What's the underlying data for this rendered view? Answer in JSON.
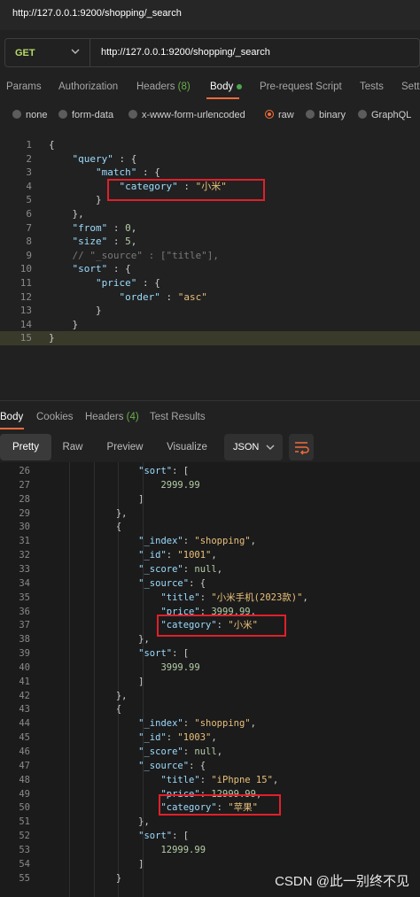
{
  "window": {
    "url_title": "http://127.0.0.1:9200/shopping/_search"
  },
  "request": {
    "method": "GET",
    "url": "http://127.0.0.1:9200/shopping/_search"
  },
  "request_tabs": {
    "params": "Params",
    "authorization": "Authorization",
    "headers": "Headers",
    "headers_count": "(8)",
    "body": "Body",
    "pre_request": "Pre-request Script",
    "tests": "Tests",
    "settings": "Settings"
  },
  "body_types": {
    "none": "none",
    "form_data": "form-data",
    "urlencoded": "x-www-form-urlencoded",
    "raw": "raw",
    "binary": "binary",
    "graphql": "GraphQL"
  },
  "request_body": [
    {
      "n": "1",
      "t": "{"
    },
    {
      "n": "2",
      "t": "    \"query\" : {"
    },
    {
      "n": "3",
      "t": "        \"match\" : {"
    },
    {
      "n": "4",
      "t": "            \"category\" : \"小米\""
    },
    {
      "n": "5",
      "t": "        }"
    },
    {
      "n": "6",
      "t": "    },"
    },
    {
      "n": "7",
      "t": "    \"from\" : 0,"
    },
    {
      "n": "8",
      "t": "    \"size\" : 5,"
    },
    {
      "n": "9",
      "t": "    // \"_source\" : [\"title\"],"
    },
    {
      "n": "10",
      "t": "    \"sort\" : {"
    },
    {
      "n": "11",
      "t": "        \"price\" : {"
    },
    {
      "n": "12",
      "t": "            \"order\" : \"asc\""
    },
    {
      "n": "13",
      "t": "        }"
    },
    {
      "n": "14",
      "t": "    }"
    },
    {
      "n": "15",
      "t": "}"
    }
  ],
  "response_tabs": {
    "body": "Body",
    "cookies": "Cookies",
    "headers": "Headers",
    "headers_count": "(4)",
    "test_results": "Test Results"
  },
  "view_modes": {
    "pretty": "Pretty",
    "raw": "Raw",
    "preview": "Preview",
    "visualize": "Visualize",
    "format": "JSON"
  },
  "response_body": [
    {
      "n": "26",
      "t": "                \"sort\": ["
    },
    {
      "n": "27",
      "t": "                    2999.99"
    },
    {
      "n": "28",
      "t": "                ]"
    },
    {
      "n": "29",
      "t": "            },"
    },
    {
      "n": "30",
      "t": "            {"
    },
    {
      "n": "31",
      "t": "                \"_index\": \"shopping\","
    },
    {
      "n": "32",
      "t": "                \"_id\": \"1001\","
    },
    {
      "n": "33",
      "t": "                \"_score\": null,"
    },
    {
      "n": "34",
      "t": "                \"_source\": {"
    },
    {
      "n": "35",
      "t": "                    \"title\": \"小米手机(2023款)\","
    },
    {
      "n": "36",
      "t": "                    \"price\": 3999.99,"
    },
    {
      "n": "37",
      "t": "                    \"category\": \"小米\""
    },
    {
      "n": "38",
      "t": "                },"
    },
    {
      "n": "39",
      "t": "                \"sort\": ["
    },
    {
      "n": "40",
      "t": "                    3999.99"
    },
    {
      "n": "41",
      "t": "                ]"
    },
    {
      "n": "42",
      "t": "            },"
    },
    {
      "n": "43",
      "t": "            {"
    },
    {
      "n": "44",
      "t": "                \"_index\": \"shopping\","
    },
    {
      "n": "45",
      "t": "                \"_id\": \"1003\","
    },
    {
      "n": "46",
      "t": "                \"_score\": null,"
    },
    {
      "n": "47",
      "t": "                \"_source\": {"
    },
    {
      "n": "48",
      "t": "                    \"title\": \"iPhpne 15\","
    },
    {
      "n": "49",
      "t": "                    \"price\": 12999.99,"
    },
    {
      "n": "50",
      "t": "                    \"category\": \"苹果\""
    },
    {
      "n": "51",
      "t": "                },"
    },
    {
      "n": "52",
      "t": "                \"sort\": ["
    },
    {
      "n": "53",
      "t": "                    12999.99"
    },
    {
      "n": "54",
      "t": "                ]"
    },
    {
      "n": "55",
      "t": "            }"
    }
  ],
  "watermark": "CSDN @此一别终不见",
  "colors": {
    "accent": "#f26b3a",
    "method": "#b8d96a",
    "highlight_box": "#e0202a"
  }
}
